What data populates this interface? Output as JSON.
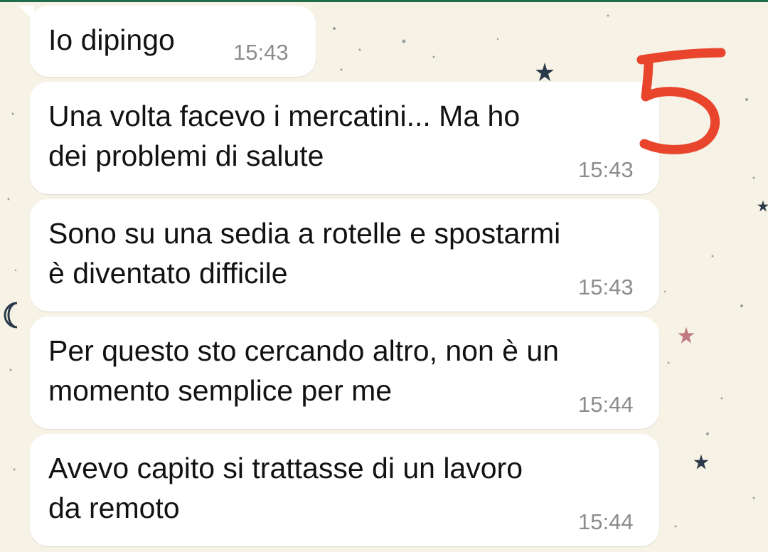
{
  "chat": {
    "messages": [
      {
        "text_lines": [
          "Io dipingo"
        ],
        "time": "15:43"
      },
      {
        "text_lines": [
          "Una volta facevo i mercatini... Ma ho",
          "dei problemi di salute"
        ],
        "time": "15:43"
      },
      {
        "text_lines": [
          "Sono su una sedia a rotelle e spostarmi",
          "è diventato difficile"
        ],
        "time": "15:43"
      },
      {
        "text_lines": [
          "Per questo sto cercando altro, non è un",
          "momento semplice per me"
        ],
        "time": "15:44"
      },
      {
        "text_lines": [
          "Avevo capito si trattasse di un lavoro",
          "da remoto"
        ],
        "time": "15:44"
      }
    ]
  },
  "annotation": {
    "label": "5",
    "color": "#e8452c"
  },
  "colors": {
    "background": "#f6f2e6",
    "bubble": "#ffffff",
    "text": "#121212",
    "timestamp": "#8c8c8c",
    "top_bar": "#1f6b4a"
  },
  "icons": {
    "wallpaper": [
      "star-icon",
      "crescent-moon-icon"
    ]
  }
}
